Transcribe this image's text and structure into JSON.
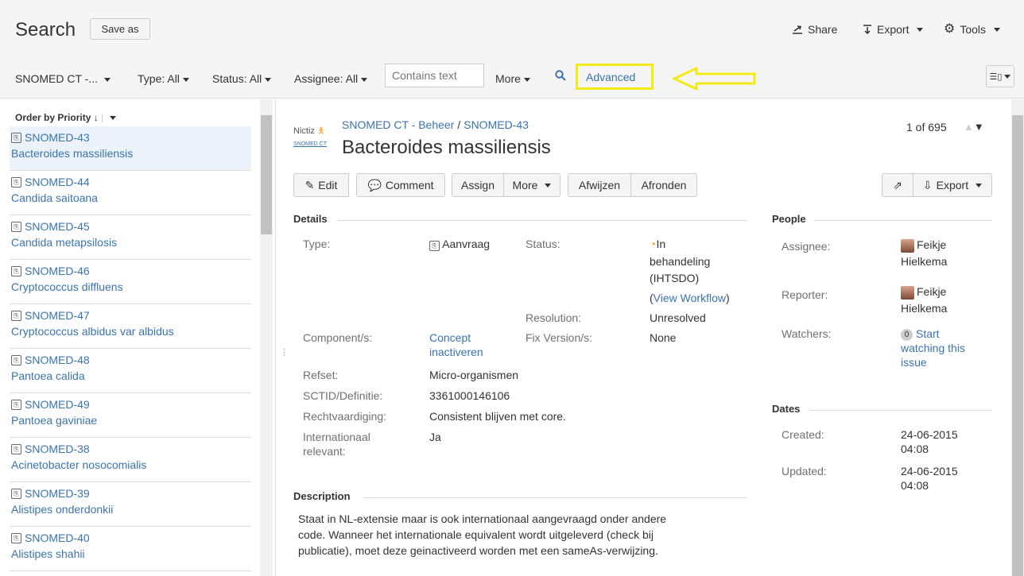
{
  "header": {
    "title": "Search",
    "save_as": "Save as",
    "share": "Share",
    "export": "Export",
    "tools": "Tools"
  },
  "filters": {
    "project": "SNOMED CT -...",
    "type": "Type: All",
    "status": "Status: All",
    "assignee": "Assignee: All",
    "contains_placeholder": "Contains text",
    "more": "More",
    "advanced": "Advanced"
  },
  "list": {
    "order_by": "Order by Priority",
    "items": [
      {
        "key": "SNOMED-43",
        "summary": "Bacteroides massiliensis"
      },
      {
        "key": "SNOMED-44",
        "summary": "Candida saitoana"
      },
      {
        "key": "SNOMED-45",
        "summary": "Candida metapsilosis"
      },
      {
        "key": "SNOMED-46",
        "summary": "Cryptococcus diffluens"
      },
      {
        "key": "SNOMED-47",
        "summary": "Cryptococcus albidus var albidus"
      },
      {
        "key": "SNOMED-48",
        "summary": "Pantoea calida"
      },
      {
        "key": "SNOMED-49",
        "summary": "Pantoea gaviniae"
      },
      {
        "key": "SNOMED-38",
        "summary": "Acinetobacter nosocomialis"
      },
      {
        "key": "SNOMED-39",
        "summary": "Alistipes onderdonkii"
      },
      {
        "key": "SNOMED-40",
        "summary": "Alistipes shahii"
      }
    ]
  },
  "issue": {
    "logo_top": "Nictiz",
    "logo_bottom": "SNOMED CT",
    "project": "SNOMED CT - Beheer",
    "key": "SNOMED-43",
    "title": "Bacteroides massiliensis",
    "pager": "1 of 695",
    "buttons": {
      "edit": "Edit",
      "comment": "Comment",
      "assign": "Assign",
      "more": "More",
      "afwijzen": "Afwijzen",
      "afronden": "Afronden",
      "export": "Export"
    },
    "details": {
      "heading": "Details",
      "type_label": "Type:",
      "type_value": "Aanvraag",
      "status_label": "Status:",
      "status_line1": "In",
      "status_line2": "behandeling",
      "status_line3": "(IHTSDO)",
      "view_workflow": "View Workflow",
      "resolution_label": "Resolution:",
      "resolution_value": "Unresolved",
      "component_label": "Component/s:",
      "component_line1": "Concept",
      "component_line2": "inactiveren",
      "fixversion_label": "Fix Version/s:",
      "fixversion_value": "None",
      "refset_label": "Refset:",
      "refset_value": "Micro-organismen",
      "sctid_label": "SCTID/Definitie:",
      "sctid_value": "3361000146106",
      "rechtvaardiging_label": "Rechtvaardiging:",
      "rechtvaardiging_value": "Consistent blijven met core.",
      "internationaal_label1": "Internationaal",
      "internationaal_label2": "relevant:",
      "internationaal_value": "Ja"
    },
    "description": {
      "heading": "Description",
      "line1": "Staat in NL-extensie maar is ook internationaal aangevraagd onder andere",
      "line2": "code. Wanneer het internationale equivalent wordt uitgeleverd (check bij",
      "line3": "publicatie), moet deze geinactiveerd worden met een sameAs-verwijzing."
    },
    "people": {
      "heading": "People",
      "assignee_label": "Assignee:",
      "assignee_first": "Feikje",
      "assignee_last": "Hielkema",
      "reporter_label": "Reporter:",
      "reporter_first": "Feikje",
      "reporter_last": "Hielkema",
      "watchers_label": "Watchers:",
      "watchers_count": "0",
      "watch_line1": "Start",
      "watch_line2": "watching this",
      "watch_line3": "issue"
    },
    "dates": {
      "heading": "Dates",
      "created_label": "Created:",
      "created_date": "24-06-2015",
      "created_time": "04:08",
      "updated_label": "Updated:",
      "updated_date": "24-06-2015",
      "updated_time": "04:08"
    }
  }
}
